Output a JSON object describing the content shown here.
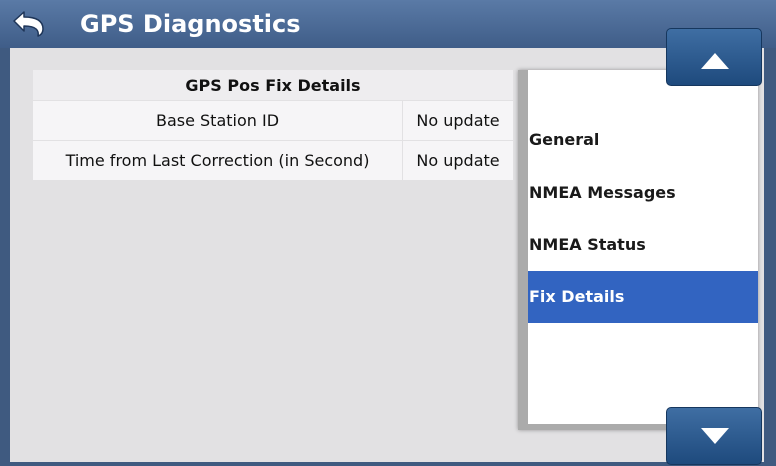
{
  "header": {
    "title": "GPS Diagnostics"
  },
  "fix_details": {
    "heading": "GPS Pos Fix Details",
    "rows": [
      {
        "label": "Base Station ID",
        "value": "No update"
      },
      {
        "label": "Time from Last Correction (in Second)",
        "value": "No update"
      }
    ]
  },
  "nav_list": {
    "items": [
      "General",
      "NMEA Messages",
      "NMEA Status",
      "Fix Details"
    ],
    "selected": "Fix Details"
  },
  "colors": {
    "title_bar": "#4a6b98",
    "selected_item": "#3264c1",
    "button": "#2a5a8f"
  }
}
